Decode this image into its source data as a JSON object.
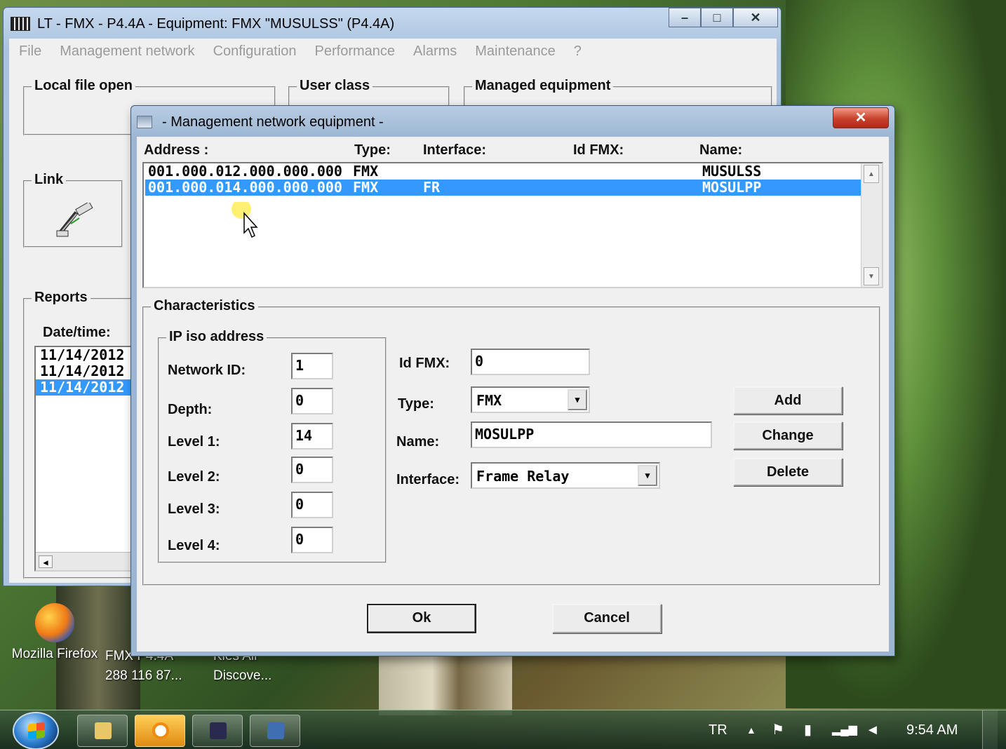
{
  "desktop": {
    "icons": [
      {
        "label": "Mozilla Firefox"
      },
      {
        "label_line1": "FMX P4.4A",
        "label_line2": "288 116 87..."
      },
      {
        "label_line1": "Kies Air",
        "label_line2": "Discove..."
      }
    ]
  },
  "taskbar": {
    "language": "TR",
    "clock": "9:54 AM"
  },
  "main_window": {
    "title": "LT - FMX - P4.4A - Equipment: FMX \"MUSULSS\" (P4.4A)",
    "menu": [
      "File",
      "Management network",
      "Configuration",
      "Performance",
      "Alarms",
      "Maintenance",
      "?"
    ],
    "groups": {
      "local_file": "Local file open",
      "user_class": "User class",
      "managed": "Managed equipment",
      "link": "Link",
      "reports": "Reports"
    },
    "reports": {
      "label": "Date/time:",
      "items": [
        "11/14/2012",
        "11/14/2012",
        "11/14/2012"
      ]
    }
  },
  "dialog": {
    "title": "- Management network equipment -",
    "columns": {
      "address": "Address :",
      "type": "Type:",
      "interface": "Interface:",
      "id": "Id FMX:",
      "name": "Name:"
    },
    "rows": [
      {
        "address": "001.000.012.000.000.000",
        "type": "FMX",
        "interface": "",
        "name": "MUSULSS"
      },
      {
        "address": "001.000.014.000.000.000",
        "type": "FMX",
        "interface": "FR",
        "name": "MOSULPP"
      }
    ],
    "characteristics": {
      "title": "Characteristics",
      "ip_title": "IP iso address",
      "labels": {
        "network_id": "Network ID:",
        "depth": "Depth:",
        "level1": "Level 1:",
        "level2": "Level 2:",
        "level3": "Level 3:",
        "level4": "Level 4:",
        "id_fmx": "Id FMX:",
        "type": "Type:",
        "name": "Name:",
        "interface": "Interface:"
      },
      "values": {
        "network_id": "1",
        "depth": "0",
        "level1": "14",
        "level2": "0",
        "level3": "0",
        "level4": "0",
        "id_fmx": "0",
        "type": "FMX",
        "name": "MOSULPP",
        "interface": "Frame Relay"
      }
    },
    "buttons": {
      "add": "Add",
      "change": "Change",
      "delete": "Delete",
      "ok": "Ok",
      "cancel": "Cancel"
    }
  }
}
